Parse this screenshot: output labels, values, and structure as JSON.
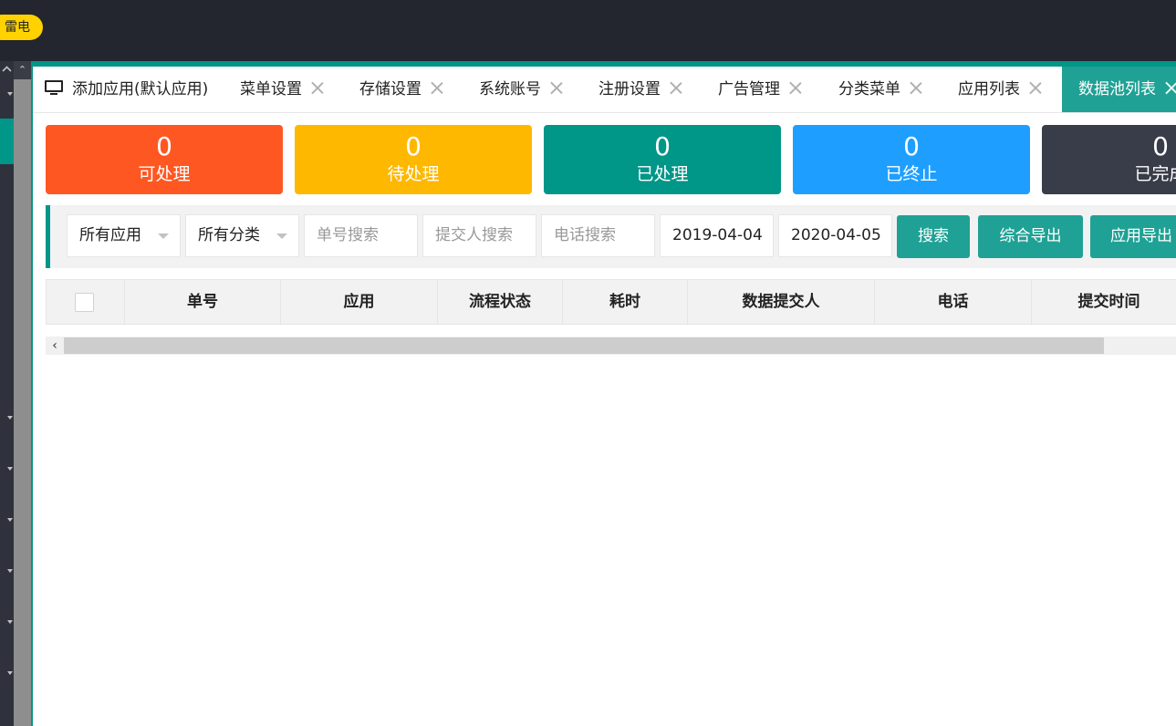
{
  "topbar": {
    "badge_label": "雷电"
  },
  "tabs": [
    {
      "label": "添加应用(默认应用)",
      "closable": false,
      "icon": "monitor-icon"
    },
    {
      "label": "菜单设置",
      "closable": true
    },
    {
      "label": "存储设置",
      "closable": true
    },
    {
      "label": "系统账号",
      "closable": true
    },
    {
      "label": "注册设置",
      "closable": true
    },
    {
      "label": "广告管理",
      "closable": true
    },
    {
      "label": "分类菜单",
      "closable": true
    },
    {
      "label": "应用列表",
      "closable": true
    },
    {
      "label": "数据池列表",
      "closable": true,
      "active": true
    }
  ],
  "stats": [
    {
      "count": "0",
      "label": "可处理",
      "color": "#ff5722"
    },
    {
      "count": "0",
      "label": "待处理",
      "color": "#ffb800"
    },
    {
      "count": "0",
      "label": "已处理",
      "color": "#009688"
    },
    {
      "count": "0",
      "label": "已终止",
      "color": "#1e9fff"
    },
    {
      "count": "0",
      "label": "已完成",
      "color": "#393d49"
    }
  ],
  "filters": {
    "app_select": "所有应用",
    "category_select": "所有分类",
    "order_placeholder": "单号搜索",
    "submitter_placeholder": "提交人搜索",
    "phone_placeholder": "电话搜索",
    "start_date": "2019-04-04",
    "end_date": "2020-04-05",
    "search_button": "搜索",
    "export_all_button": "综合导出",
    "export_app_button": "应用导出"
  },
  "table": {
    "columns": [
      "单号",
      "应用",
      "流程状态",
      "耗时",
      "数据提交人",
      "电话",
      "提交时间"
    ],
    "rows": []
  },
  "colors": {
    "accent": "#009688",
    "button": "#1fa195",
    "topbar": "#23262e",
    "sidebar": "#2f323c"
  }
}
